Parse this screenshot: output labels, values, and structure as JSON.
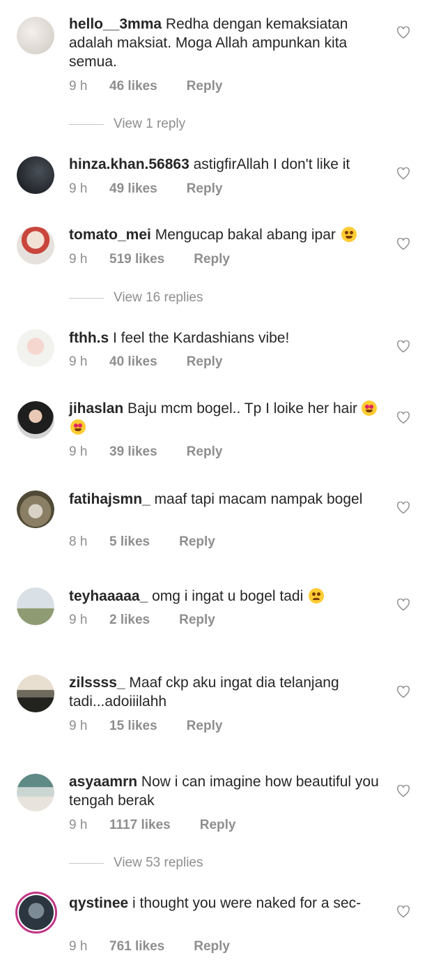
{
  "comments": [
    {
      "username": "hello__3mma",
      "text": "Redha dengan kemaksiatan adalah maksiat. Moga Allah ampunkan kita semua.",
      "time": "9 h",
      "likes": "46 likes",
      "reply": "Reply",
      "emoji": ""
    },
    {
      "username": "hinza.khan.56863",
      "text": "astigfirAllah I don't like it",
      "time": "9 h",
      "likes": "49 likes",
      "reply": "Reply",
      "emoji": ""
    },
    {
      "username": "tomato_mei",
      "text": "Mengucap bakal abang ipar",
      "time": "9 h",
      "likes": "519 likes",
      "reply": "Reply",
      "emoji": "laughing"
    },
    {
      "username": "fthh.s",
      "text": "I feel the Kardashians vibe!",
      "time": "9 h",
      "likes": "40 likes",
      "reply": "Reply",
      "emoji": ""
    },
    {
      "username": "jihaslan",
      "text": "Baju mcm bogel.. Tp I loike her hair",
      "time": "9 h",
      "likes": "39 likes",
      "reply": "Reply",
      "emoji": "heart-eyes x2"
    },
    {
      "username": "fatihajsmn_",
      "text": "maaf tapi macam nampak bogel",
      "time": "8 h",
      "likes": "5 likes",
      "reply": "Reply",
      "emoji": ""
    },
    {
      "username": "teyhaaaaa_",
      "text": "omg i ingat u bogel tadi",
      "time": "9 h",
      "likes": "2 likes",
      "reply": "Reply",
      "emoji": "worried"
    },
    {
      "username": "zilssss_",
      "text": "Maaf ckp aku ingat dia telanjang tadi...adoiiilahh",
      "time": "9 h",
      "likes": "15 likes",
      "reply": "Reply",
      "emoji": ""
    },
    {
      "username": "asyaamrn",
      "text": "Now i can imagine how beautiful you tengah berak",
      "time": "9 h",
      "likes": "1117 likes",
      "reply": "Reply",
      "emoji": ""
    },
    {
      "username": "qystinee",
      "text": "i thought you were naked for a sec-",
      "time": "9 h",
      "likes": "761 likes",
      "reply": "Reply",
      "emoji": ""
    }
  ],
  "view_replies": [
    "View 1 reply",
    "View 16 replies",
    "View 53 replies"
  ],
  "colors": {
    "text": "#262626",
    "muted": "#8e8e8e",
    "story_ring": "#c13584",
    "divider": "#c7c7c7"
  },
  "icons": {
    "like": "heart-outline-icon"
  }
}
